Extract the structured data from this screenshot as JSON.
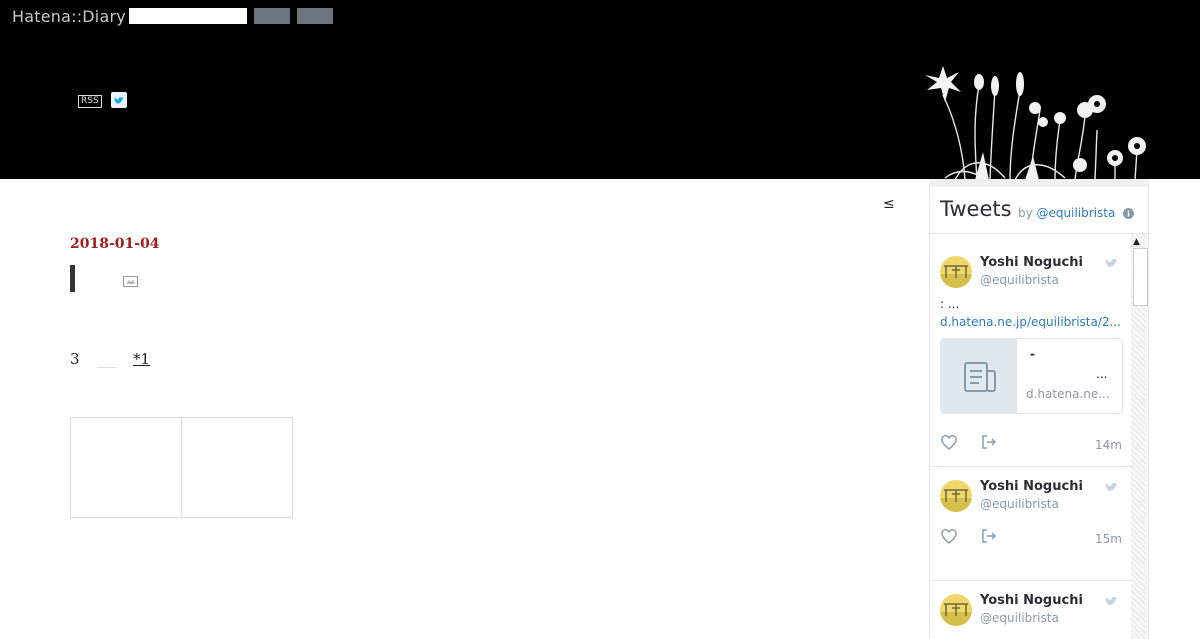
{
  "header": {
    "logo_text": "Hatena::Diary",
    "search_value": "",
    "rss_label": "RSS",
    "icons": [
      "rss-icon",
      "twitter-icon",
      "flower-illustration"
    ]
  },
  "nav": {
    "prev_label": "≤"
  },
  "entry": {
    "date": "2018-01-04",
    "body_number": "3",
    "footnote_label": "*1"
  },
  "twitter_widget": {
    "title": "Tweets",
    "by_label": "by",
    "handle": "@equilibrista",
    "tweets": [
      {
        "name": "Yoshi Noguchi",
        "screen_name": "@equilibrista",
        "text": ": ...",
        "link": "d.hatena.ne.jp/equilibrista/2...",
        "card": {
          "title": "-",
          "description": "...",
          "domain": "d.hatena.ne..."
        },
        "time": "14m"
      },
      {
        "name": "Yoshi Noguchi",
        "screen_name": "@equilibrista",
        "time": "15m"
      },
      {
        "name": "Yoshi Noguchi",
        "screen_name": "@equilibrista"
      }
    ]
  },
  "colors": {
    "topbar": "#000000",
    "date": "#a11d1d",
    "link": "#2b7bb9"
  }
}
